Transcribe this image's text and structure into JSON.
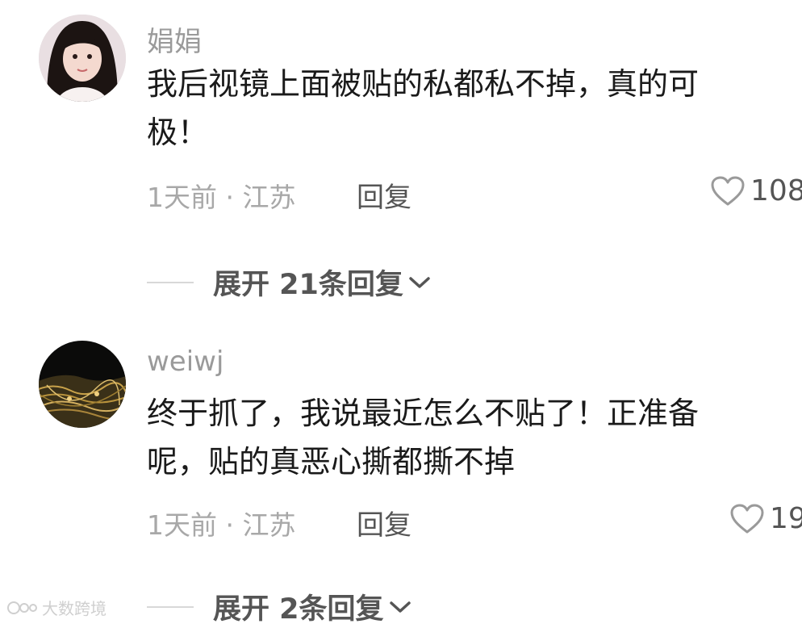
{
  "comments": [
    {
      "username": "娟娟",
      "lines": [
        "我后视镜上面被贴的私都私不掉，真的可",
        "极！"
      ],
      "time_location": "1天前 · 江苏",
      "reply_label": "回复",
      "like_count": "108",
      "expand_label": "展开 21条回复"
    },
    {
      "username": "weiwj",
      "lines": [
        "终于抓了，我说最近怎么不贴了！正准备",
        "呢，贴的真恶心撕都撕不掉"
      ],
      "time_location": "1天前 · 江苏",
      "reply_label": "回复",
      "like_count": "19",
      "expand_label": "展开 2条回复"
    }
  ],
  "watermark": "大数跨境",
  "icons": {
    "like": "heart-outline-icon",
    "expand": "chevron-down-icon",
    "watermark": "watermark-logo-icon"
  },
  "colors": {
    "username": "#9a9a9a",
    "content": "#1a1a1a",
    "meta": "#a8a8a8",
    "action": "#555555"
  }
}
